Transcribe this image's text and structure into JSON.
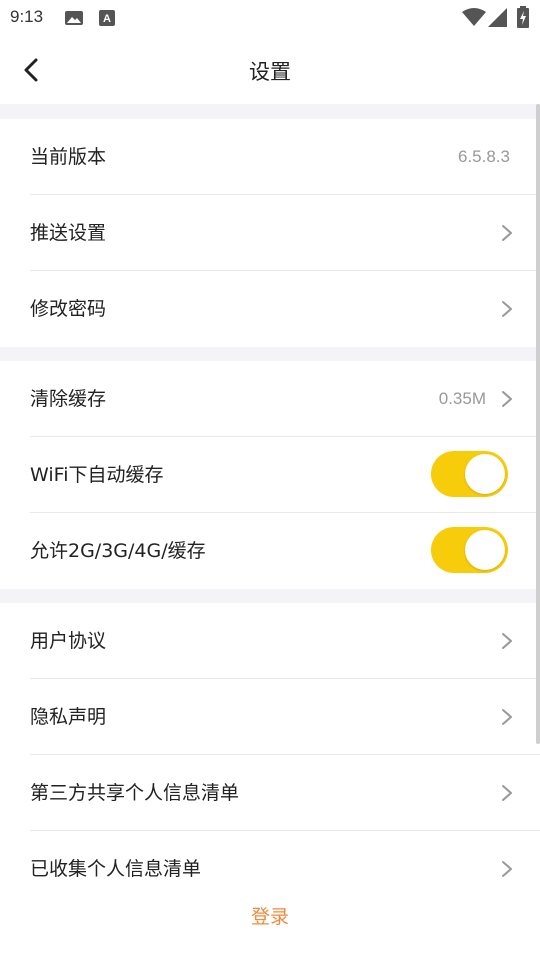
{
  "status_bar": {
    "time": "9:13",
    "icons": [
      "image-icon",
      "text-a-icon",
      "wifi-icon",
      "cellular-icon",
      "battery-charging-icon"
    ]
  },
  "header": {
    "title": "设置",
    "back_icon": "chevron-left-icon"
  },
  "settings": {
    "version": {
      "label": "当前版本",
      "value": "6.5.8.3"
    },
    "push": {
      "label": "推送设置"
    },
    "password": {
      "label": "修改密码"
    },
    "cache": {
      "label": "清除缓存",
      "value": "0.35M"
    },
    "wifi_cache": {
      "label": "WiFi下自动缓存",
      "enabled": true
    },
    "mobile_cache": {
      "label": "允许2G/3G/4G/缓存",
      "enabled": true
    },
    "agreement": {
      "label": "用户协议"
    },
    "privacy": {
      "label": "隐私声明"
    },
    "third_party": {
      "label": "第三方共享个人信息清单"
    },
    "collected": {
      "label": "已收集个人信息清单"
    }
  },
  "login_label": "登录",
  "colors": {
    "accent_toggle": "#f7cc0a",
    "login_text": "#f08a3c",
    "section_gap": "#f4f4f8"
  }
}
